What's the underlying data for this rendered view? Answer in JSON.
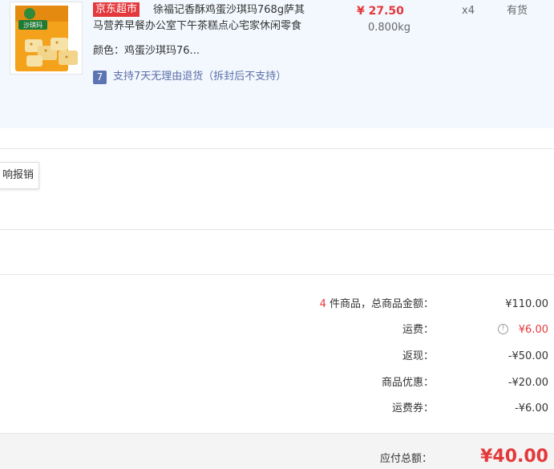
{
  "product": {
    "store_badge": "京东超市",
    "title": "徐福记香酥鸡蛋沙琪玛768g萨其马营养早餐办公室下午茶糕点心宅家休闲零食",
    "image_brand_text": "沙琪玛",
    "price": "¥ 27.50",
    "weight": "0.800kg",
    "quantity": "x4",
    "stock": "有货",
    "spec_label": "颜色：",
    "spec_value": "鸡蛋沙琪玛76...",
    "return_icon": "7",
    "return_policy": "支持7天无理由退货（拆封后不支持）"
  },
  "report_button": "响报销",
  "summary": {
    "count": "4",
    "count_suffix": " 件商品，总商品金额：",
    "goods_total": "¥110.00",
    "shipping_label": "运费：",
    "shipping_info_icon": "!",
    "shipping_value": "¥6.00",
    "cashback_label": "返现：",
    "cashback_value": "-¥50.00",
    "discount_label": "商品优惠：",
    "discount_value": "-¥20.00",
    "coupon_label": "运费券：",
    "coupon_value": "-¥6.00",
    "payable_label": "应付总额：",
    "payable_value": "¥40.00"
  },
  "colors": {
    "accent_red": "#e4393c",
    "product_bg": "#f3f8fe",
    "policy_blue": "#5c6ea8"
  }
}
